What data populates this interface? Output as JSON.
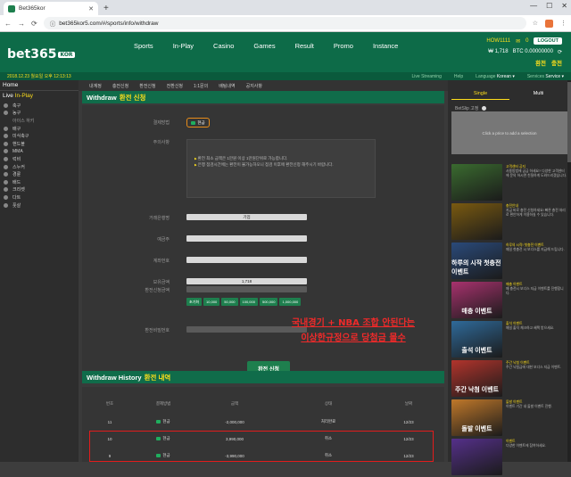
{
  "browser": {
    "tab_title": "Bet365kor",
    "url": "bet365kor5.com/#/sports/info/withdraw"
  },
  "header": {
    "logo": "bet365",
    "logo_suffix": "KOR",
    "nav": [
      "Sports",
      "In-Play",
      "Casino",
      "Games",
      "Result",
      "Promo",
      "Instance"
    ],
    "user": "HOW1111",
    "msg_count": "0",
    "logout": "LOGOUT",
    "balance": "₩ 1,718",
    "btc": "BTC 0.00000000",
    "links": [
      "환전",
      "충전"
    ]
  },
  "subheader": {
    "datetime": "2018.12.23 월요일 오후 12:13:13",
    "live": "Live Streaming",
    "help": "Help",
    "language_label": "Language",
    "language": "Korean ▾",
    "services_label": "Services",
    "service": "Service ▾"
  },
  "sidebar": {
    "home": "Home",
    "live_prefix": "Live ",
    "live_suffix": "In-Play",
    "items": [
      {
        "label": "축구",
        "sub": false
      },
      {
        "label": "농구",
        "sub": false
      },
      {
        "label": "아이스 하키",
        "sub": true
      },
      {
        "label": "배구",
        "sub": false
      },
      {
        "label": "미식축구",
        "sub": false
      },
      {
        "label": "핸드볼",
        "sub": false
      },
      {
        "label": "MMA",
        "sub": false
      },
      {
        "label": "럭비",
        "sub": false
      },
      {
        "label": "스누커",
        "sub": false
      },
      {
        "label": "경륜",
        "sub": false
      },
      {
        "label": "배드",
        "sub": false
      },
      {
        "label": "크리켓",
        "sub": false
      },
      {
        "label": "다트",
        "sub": false
      },
      {
        "label": "풋살",
        "sub": false
      }
    ]
  },
  "topnav": [
    "내계정",
    "충전신청",
    "환전신청",
    "전환신청",
    "1:1문의",
    "배팅내역",
    "공지사항"
  ],
  "withdraw": {
    "title": "Withdraw",
    "title_ko": "환전 신청",
    "method_label": "결제방법",
    "method": "현금",
    "notice_label": "주의사항",
    "notice": [
      "환전 최소 금액은 1만원 이상 1만원단위로 가능합니다.",
      "은행 점검시간에는 환전이 불가능하오니 점검 이후에 환전신청 해주시기 바랍니다."
    ],
    "bank_label": "거래은행명",
    "bank": "기업",
    "holder_label": "예금주",
    "account_label": "계좌번호",
    "balance_label": "보유금액",
    "balance": "1,718",
    "amount_label": "환전신청금액",
    "amount_buttons": [
      "초기화",
      "10,000",
      "50,000",
      "100,000",
      "500,000",
      "1,000,000"
    ],
    "password_label": "환전비밀번호",
    "submit": "환전 신청"
  },
  "overlay": {
    "line1": "국내경기 + NBA 조합 안된다는",
    "line2": "이상한규정으로 당첨금 몰수"
  },
  "history": {
    "title": "Withdraw History",
    "title_ko": "환전 내역",
    "columns": [
      "번호",
      "결제방법",
      "금액",
      "상태",
      "날짜"
    ],
    "rows": [
      {
        "no": "11",
        "method": "현금",
        "amount": "-2,000,000",
        "status": "처리완료",
        "date": "12/23"
      },
      {
        "no": "10",
        "method": "현금",
        "amount": "3,990,000",
        "status": "취소",
        "date": "12/23"
      },
      {
        "no": "9",
        "method": "현금",
        "amount": "-3,990,000",
        "status": "취소",
        "date": "12/23"
      }
    ]
  },
  "betslip": {
    "tab_single": "Single",
    "tab_multi": "Multi",
    "betslip_label": "BetSlip 고정",
    "empty": "Click a price to add a selection"
  },
  "promos": [
    {
      "img": "",
      "color": "#3a6b2f",
      "title": "고객센터 공지",
      "text": "사용방법에 궁금 하세요? 다양한 고객센터에 문의 하시면 친절하게 도와드리겠습니다."
    },
    {
      "img": "",
      "color": "#7a5a10",
      "title": "충전안내",
      "text": "지금 바로 충전 신청하세요! 빠른 충전 처리로 편안하게 이용하실 수 있습니다."
    },
    {
      "img": "하루의 시작 첫충전 이벤트",
      "color": "#2a4a7a",
      "title": "하루의 시작! 첫충전 이벤트",
      "text": "매일 첫충전 시 보너스를 지급해 드립니다."
    },
    {
      "img": "매충 이벤트",
      "color": "#a8326e",
      "title": "매충 이벤트",
      "text": "매 충전시 보너스 지급 이벤트를 진행합니다."
    },
    {
      "img": "출석 이벤트",
      "color": "#2f6a9a",
      "title": "출석 이벤트",
      "text": "매일 출석 체크하고 혜택 받으세요."
    },
    {
      "img": "주간 낙첨 이벤트",
      "color": "#b2342c",
      "title": "주간 낙첨 이벤트",
      "text": "주간 낙첨금에 대한 보너스 지급 이벤트."
    },
    {
      "img": "돌발 이벤트",
      "color": "#c0782a",
      "title": "돌발 이벤트",
      "text": "이벤트 기간 내 돌발 이벤트 진행."
    },
    {
      "img": "",
      "color": "#55308a",
      "title": "이벤트",
      "text": "다양한 이벤트에 참여하세요."
    }
  ]
}
